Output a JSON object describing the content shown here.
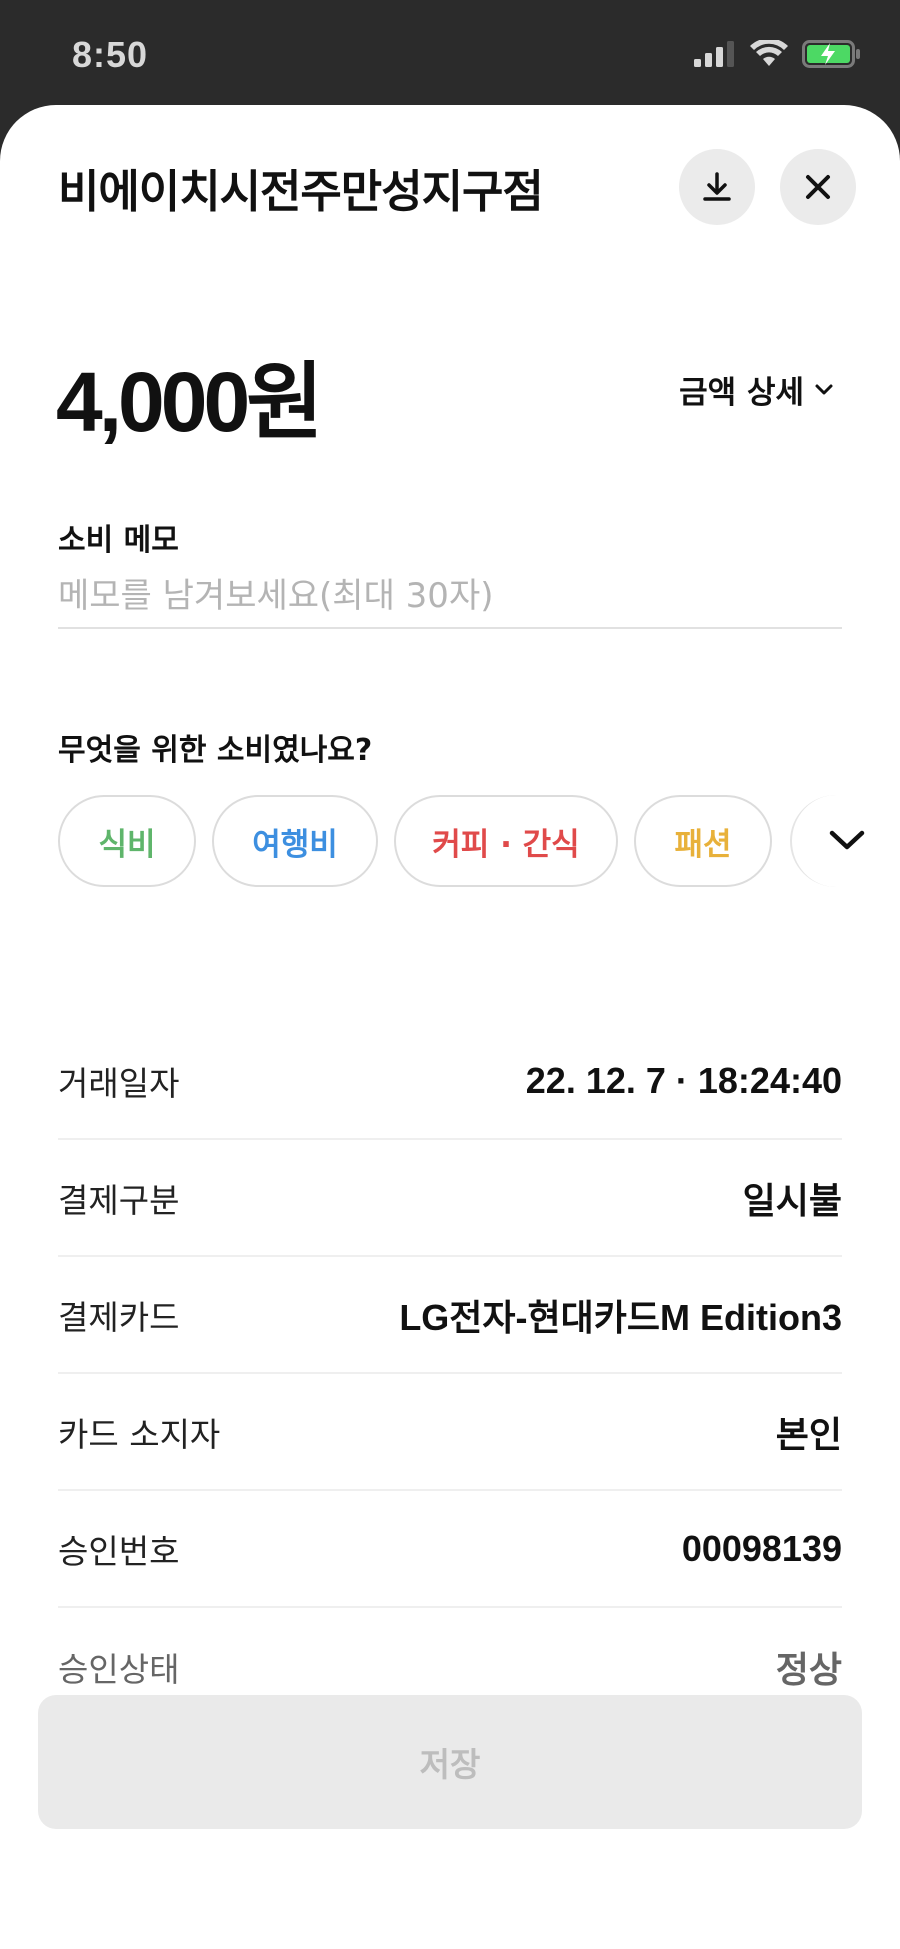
{
  "status_bar": {
    "time": "8:50"
  },
  "header": {
    "title": "비에이치시전주만성지구점",
    "download_icon": "download-icon",
    "close_icon": "close-icon"
  },
  "amount": {
    "value": "4,000원",
    "detail_label": "금액 상세"
  },
  "memo": {
    "label": "소비 메모",
    "placeholder": "메모를 남겨보세요(최대 30자)",
    "value": ""
  },
  "category": {
    "question": "무엇을 위한 소비였나요?",
    "chips": [
      {
        "label": "식비",
        "color": "#5fb56b"
      },
      {
        "label": "여행비",
        "color": "#3d8fe0"
      },
      {
        "label": "커피 · 간식",
        "color": "#e04a4a"
      },
      {
        "label": "패션",
        "color": "#e8b13a"
      }
    ]
  },
  "details": [
    {
      "label": "거래일자",
      "value": "22. 12. 7 · 18:24:40"
    },
    {
      "label": "결제구분",
      "value": "일시불"
    },
    {
      "label": "결제카드",
      "value": "LG전자-현대카드M Edition3"
    },
    {
      "label": "카드 소지자",
      "value": "본인"
    },
    {
      "label": "승인번호",
      "value": "00098139"
    },
    {
      "label": "승인상태",
      "value": "정상"
    }
  ],
  "save_button": {
    "label": "저장"
  }
}
